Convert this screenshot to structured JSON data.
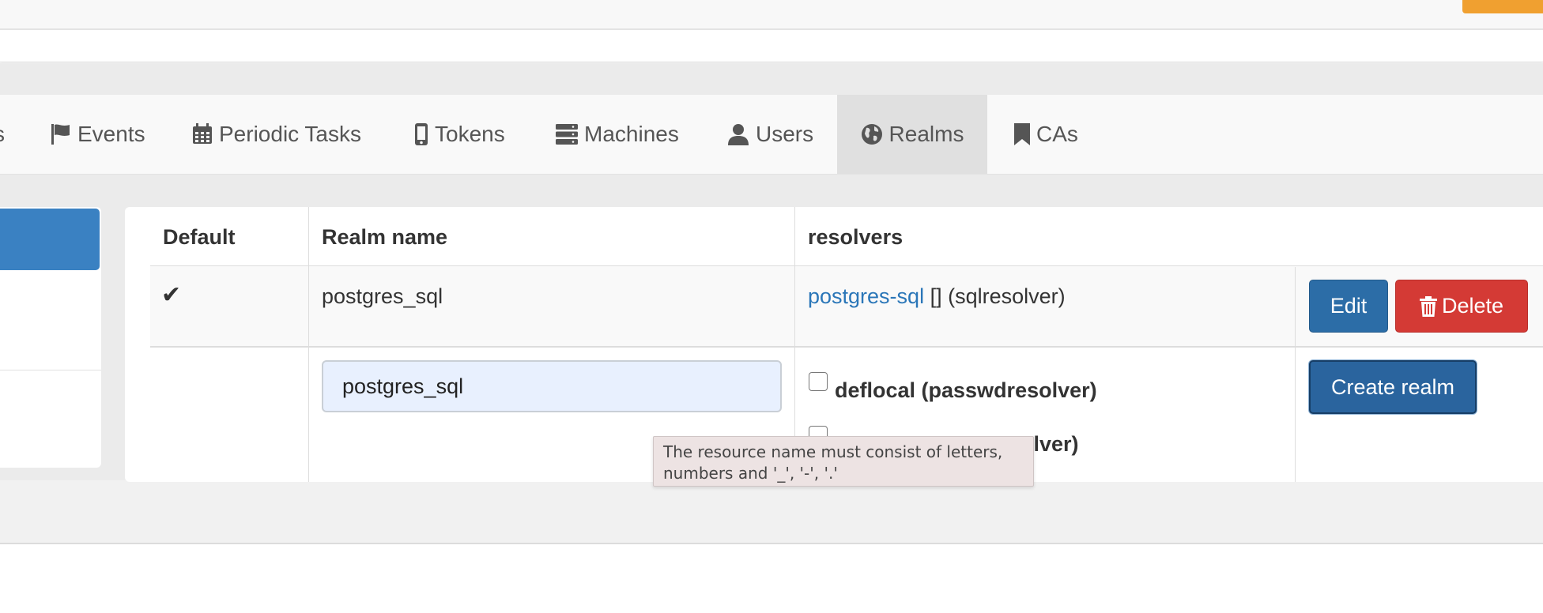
{
  "nav": {
    "tabs": [
      {
        "label": "Events",
        "icon": "flag-icon"
      },
      {
        "label": "Periodic Tasks",
        "icon": "calendar-icon"
      },
      {
        "label": "Tokens",
        "icon": "mobile-icon"
      },
      {
        "label": "Machines",
        "icon": "server-icon"
      },
      {
        "label": "Users",
        "icon": "user-icon"
      },
      {
        "label": "Realms",
        "icon": "globe-icon",
        "active": true
      },
      {
        "label": "CAs",
        "icon": "bookmark-icon"
      }
    ]
  },
  "table": {
    "headers": {
      "default": "Default",
      "realm_name": "Realm name",
      "resolvers": "resolvers"
    },
    "rows": [
      {
        "default_mark": "✔",
        "realm_name": "postgres_sql",
        "resolver_link": "postgres-sql",
        "resolver_suffix": " [] (sqlresolver)",
        "edit_label": "Edit",
        "delete_label": "Delete"
      }
    ]
  },
  "new_realm": {
    "name_value": "postgres_sql",
    "resolver_options": [
      {
        "label": "deflocal (passwdresolver)",
        "checked": false
      },
      {
        "label": "solver)",
        "checked": false
      }
    ],
    "create_label": "Create realm"
  },
  "tooltip": {
    "text": "The resource name must consist of letters,\nnumbers and '_', '-', '.'"
  },
  "colors": {
    "primary": "#2c6da7",
    "danger": "#d43a35",
    "link": "#2a76b8",
    "accent_orange": "#f0a030"
  }
}
